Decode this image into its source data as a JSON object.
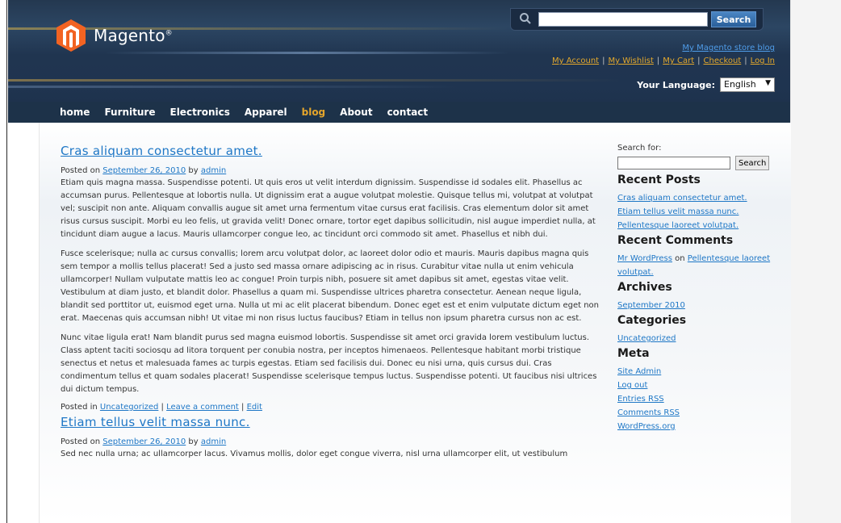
{
  "header": {
    "logo_text": "Magento",
    "logo_reg": "®",
    "search_placeholder": "",
    "search_button": "Search",
    "store_link": "My Magento store blog",
    "top_links": [
      "My Account",
      "My Wishlist",
      "My Cart",
      "Checkout",
      "Log In"
    ],
    "language_label": "Your Language:",
    "language_value": "English"
  },
  "nav": [
    "home",
    "Furniture",
    "Electronics",
    "Apparel",
    "blog",
    "About",
    "contact"
  ],
  "nav_active": "blog",
  "posts": [
    {
      "title": "Cras aliquam consectetur amet.",
      "meta_prefix": "Posted on",
      "date": "September 26, 2010",
      "by": "by",
      "author": "admin",
      "paragraphs": [
        "Etiam quis magna massa. Suspendisse potenti. Ut quis eros ut velit interdum dignissim. Suspendisse id sodales elit. Phasellus ac accumsan purus. Pellentesque at lobortis nulla. Ut dignissim erat a augue volutpat molestie. Quisque tellus mi, volutpat at volutpat vel; suscipit non ante. Aliquam convallis augue sit amet urna fermentum vitae cursus erat facilisis. Cras elementum dolor sit amet risus cursus suscipit. Morbi eu leo felis, ut gravida velit! Donec ornare, tortor eget dapibus sollicitudin, nisl augue imperdiet nulla, at tincidunt diam augue a lacus. Mauris ullamcorper congue leo, ac tincidunt orci commodo sit amet. Phasellus et nibh dui.",
        "Fusce scelerisque; nulla ac cursus convallis; lorem arcu volutpat dolor, ac laoreet dolor odio et mauris. Mauris dapibus magna quis sem tempor a mollis tellus placerat! Sed a justo sed massa ornare adipiscing ac in risus. Curabitur vitae nulla ut enim vehicula ullamcorper! Nullam vulputate mattis leo ac congue! Proin turpis nibh, posuere sit amet dapibus sit amet, egestas vitae velit. Vestibulum at diam justo, et blandit dolor. Phasellus a quam mi. Suspendisse ultrices pharetra consectetur. Aenean neque ligula, blandit sed porttitor ut, euismod eget urna. Nulla ut mi ac elit placerat bibendum. Donec eget est et enim vulputate dictum eget non erat. Maecenas quis accumsan nibh! Ut vitae mi non risus luctus faucibus? Etiam in tellus non ipsum pharetra cursus non ac est.",
        "Nunc vitae ligula erat! Nam blandit purus sed magna euismod lobortis. Suspendisse sit amet orci gravida lorem vestibulum luctus. Class aptent taciti sociosqu ad litora torquent per conubia nostra, per inceptos himenaeos. Pellentesque habitant morbi tristique senectus et netus et malesuada fames ac turpis egestas. Etiam sed facilisis dui. Donec eu nisi urna, quis cursus dui. Cras condimentum tellus et quam sodales placerat! Suspendisse scelerisque tempus luctus. Suspendisse potenti. Ut faucibus nisi ultrices dui dictum tempus."
      ],
      "footer_prefix": "Posted in",
      "category": "Uncategorized",
      "comment": "Leave a comment",
      "edit": "Edit"
    },
    {
      "title": "Etiam tellus velit massa nunc.",
      "meta_prefix": "Posted on",
      "date": "September 26, 2010",
      "by": "by",
      "author": "admin",
      "paragraphs": [
        "Sed nec nulla urna; ac ullamcorper lacus. Vivamus mollis, dolor eget congue viverra, nisl urna ullamcorper elit, ut vestibulum"
      ]
    }
  ],
  "sidebar": {
    "search_label": "Search for:",
    "search_button": "Search",
    "recent_posts_title": "Recent Posts",
    "recent_posts": [
      "Cras aliquam consectetur amet.",
      "Etiam tellus velit massa nunc.",
      "Pellentesque laoreet volutpat."
    ],
    "recent_comments_title": "Recent Comments",
    "comment_author": "Mr WordPress",
    "comment_on": "on",
    "comment_post": "Pellentesque laoreet volutpat.",
    "archives_title": "Archives",
    "archives": [
      "September 2010"
    ],
    "categories_title": "Categories",
    "categories": [
      "Uncategorized"
    ],
    "meta_title": "Meta",
    "meta_links": [
      "Site Admin",
      "Log out",
      "Entries RSS",
      "Comments RSS",
      "WordPress.org"
    ]
  }
}
